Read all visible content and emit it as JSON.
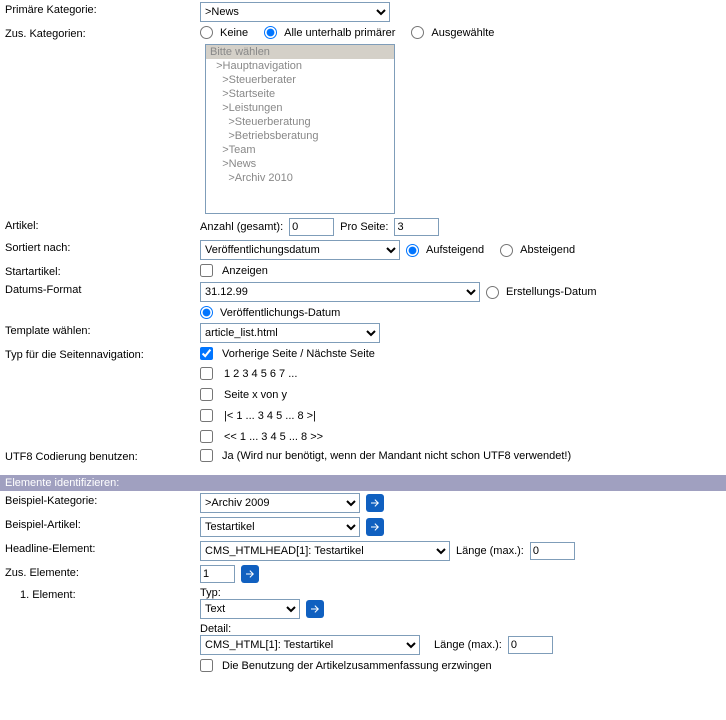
{
  "labels": {
    "primary_cat": "Primäre Kategorie:",
    "add_cats": "Zus. Kategorien:",
    "article": "Artikel:",
    "sorted_by": "Sortiert nach:",
    "start_article": "Startartikel:",
    "date_format": "Datums-Format",
    "template": "Template wählen:",
    "nav_type": "Typ für die Seitennavigation:",
    "utf8": "UTF8 Codierung benutzen:",
    "example_cat": "Beispiel-Kategorie:",
    "example_art": "Beispiel-Artikel:",
    "headline_elem": "Headline-Element:",
    "add_elems": "Zus. Elemente:",
    "elem1": "1. Element:",
    "anzahl": "Anzahl (gesamt):",
    "pro_seite": "Pro Seite:",
    "anzeigen": "Anzeigen",
    "laenge_max": "Länge (max.):",
    "typ": "Typ:",
    "detail": "Detail:"
  },
  "primary_category": "        >News",
  "cat_radios": {
    "none": "Keine",
    "all_below": "Alle unterhalb primärer",
    "selected": "Ausgewählte"
  },
  "listbox": {
    "0": "Bitte wählen",
    "1": "  >Hauptnavigation",
    "2": "    >Steuerberater",
    "3": "    >Startseite",
    "4": "    >Leistungen",
    "5": "      >Steuerberatung",
    "6": "      >Betriebsberatung",
    "7": "    >Team",
    "8": "    >News",
    "9": "      >Archiv 2010"
  },
  "article_count": "0",
  "per_page": "3",
  "sort_field": "Veröffentlichungsdatum",
  "sort_asc": "Aufsteigend",
  "sort_desc": "Absteigend",
  "date_format_value": "31.12.99",
  "date_create": "Erstellungs-Datum",
  "date_publish": "Veröffentlichungs-Datum",
  "template_value": "article_list.html",
  "nav": {
    "prev_next": "Vorherige Seite / Nächste Seite",
    "numbers": "1 2 3 4 5 6 7 ...",
    "x_of_y": "Seite x von y",
    "range1": "|< 1 ... 3 4 5 ... 8 >|",
    "range2": "<< 1 ... 3 4 5 ... 8 >>"
  },
  "utf8_text": "Ja (Wird nur benötigt, wenn der Mandant nicht schon UTF8 verwendet!)",
  "section_identify": "Elemente identifizieren:",
  "example_category": "        >Archiv 2009",
  "example_article": "Testartikel",
  "headline_value": "CMS_HTMLHEAD[1]: Testartikel",
  "headline_len": "0",
  "add_elem_count": "1",
  "elem1_type": "Text",
  "elem1_detail": "CMS_HTML[1]: Testartikel",
  "elem1_len": "0",
  "force_summary": "Die Benutzung der Artikelzusammenfassung erzwingen"
}
